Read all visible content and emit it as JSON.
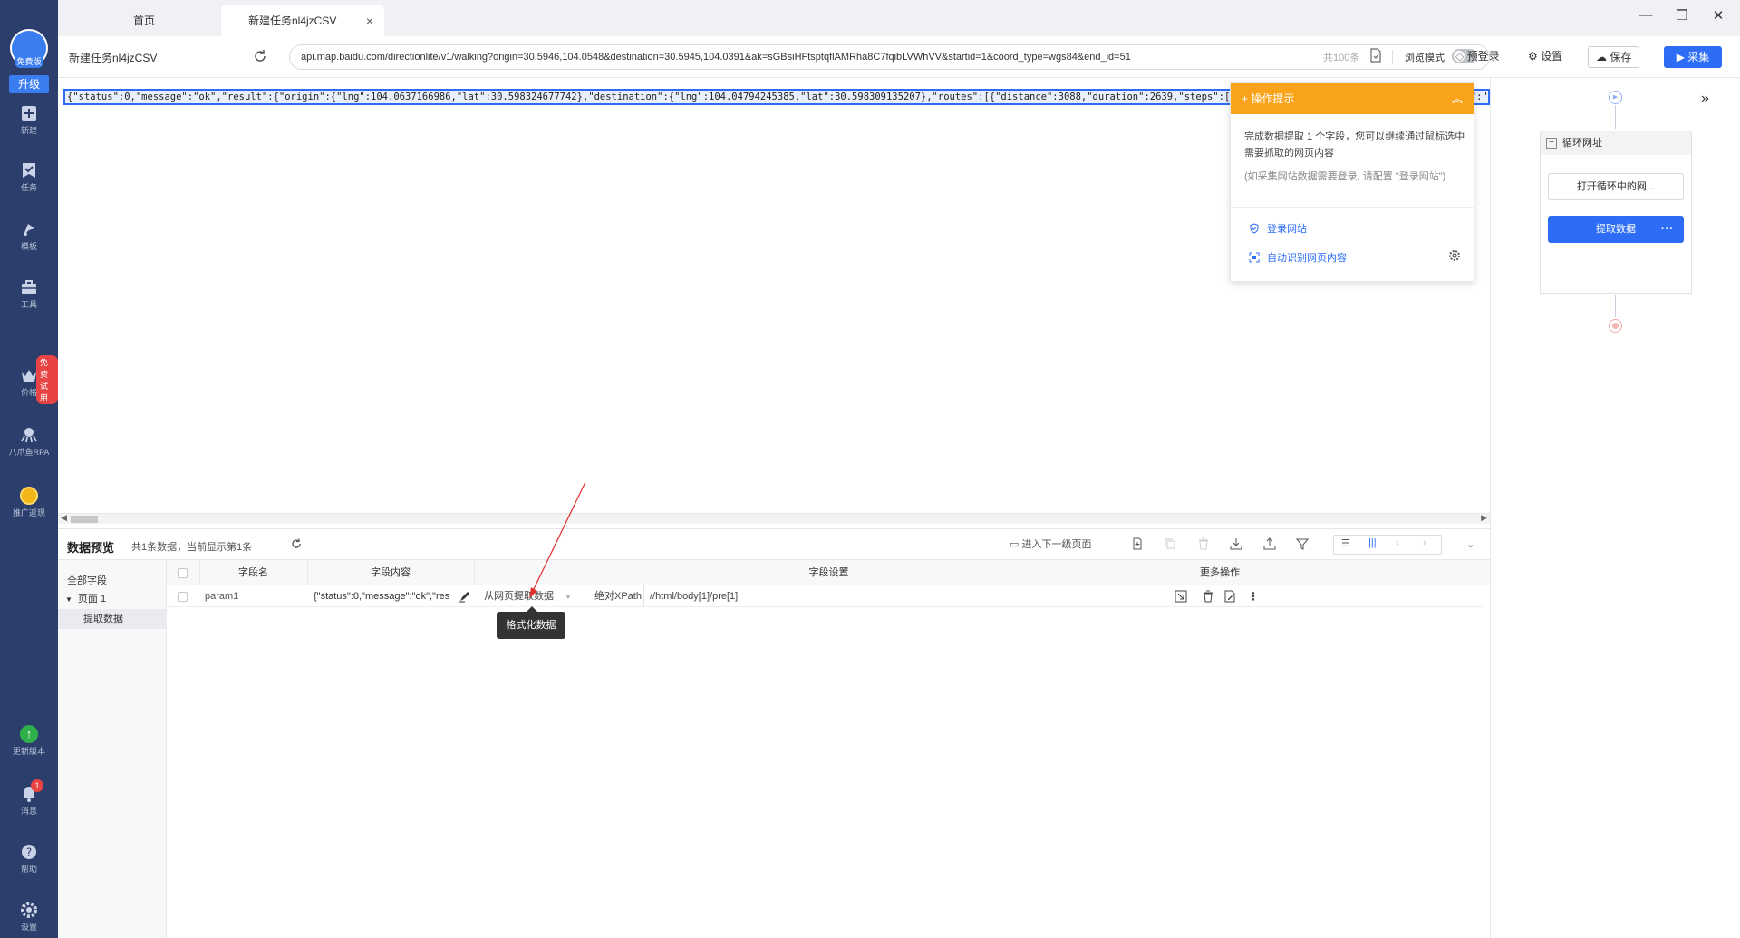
{
  "sidebar": {
    "logo_badge": "免费版",
    "upgrade": "升级",
    "items": [
      {
        "label": "新建",
        "icon": "plus-square-icon"
      },
      {
        "label": "任务",
        "icon": "task-icon"
      },
      {
        "label": "模板",
        "icon": "template-icon"
      },
      {
        "label": "工具",
        "icon": "toolbox-icon"
      },
      {
        "label": "价格",
        "icon": "crown-icon"
      },
      {
        "label": "八爪鱼RPA",
        "icon": "octopus-icon"
      },
      {
        "label": "推广返现",
        "icon": "coin-icon"
      },
      {
        "label": "更新版本",
        "icon": "upgrade-arrow-icon"
      },
      {
        "label": "消息",
        "icon": "bell-icon"
      },
      {
        "label": "帮助",
        "icon": "help-icon"
      },
      {
        "label": "设置",
        "icon": "settings-icon"
      }
    ],
    "promo_badge": "免费试用",
    "message_count": "1"
  },
  "tabs": {
    "home": "首页",
    "current": "新建任务nl4jzCSV"
  },
  "addressbar": {
    "page_title": "新建任务nl4jzCSV",
    "url": "api.map.baidu.com/directionlite/v1/walking?origin=30.5946,104.0548&destination=30.5945,104.0391&ak=sGBsiHFtsptqflAMRha8C7fqibLVWhVV&startid=1&coord_type=wgs84&end_id=51",
    "count": "共100条",
    "browse_mode": "浏览模式",
    "preview_login": "预登录",
    "settings": "设置",
    "save": "保存",
    "collect": "采集"
  },
  "webview": {
    "json_text": "{\"status\":0,\"message\":\"ok\",\"result\":{\"origin\":{\"lng\":104.0637166986,\"lat\":30.598324677742},\"destination\":{\"lng\":104.04794245385,\"lat\":30.598309135207},\"routes\":[{\"distance\":3088,\"duration\":2639,\"steps\":[{\"leg_index\":0,\"road_name\":\"\",\"instruction\":\"起点\"}]}]}}"
  },
  "hint": {
    "title": "操作提示",
    "text1": "完成数据提取 1 个字段，您可以继续通过鼠标选中需要抓取的网页内容",
    "text2": "(如采集网站数据需要登录, 请配置 \"登录网站\")",
    "link_login": "登录网站",
    "link_auto": "自动识别网页内容"
  },
  "flow": {
    "loop_title": "循环网址",
    "open_node": "打开循环中的网...",
    "extract_node": "提取数据"
  },
  "preview": {
    "title": "数据预览",
    "info": "共1条数据，当前显示第1条",
    "next_level": "进入下一级页面",
    "tree": {
      "all_fields": "全部字段",
      "page": "页面 1",
      "extract": "提取数据"
    },
    "columns": [
      "字段名",
      "字段内容",
      "字段设置",
      "更多操作"
    ],
    "rows": [
      {
        "name": "param1",
        "content": "{\"status\":0,\"message\":\"ok\",\"result\":{...",
        "source": "从网页提取数据",
        "xpath_type": "绝对XPath",
        "xpath": "//html/body[1]/pre[1]"
      }
    ],
    "tooltip": "格式化数据"
  }
}
